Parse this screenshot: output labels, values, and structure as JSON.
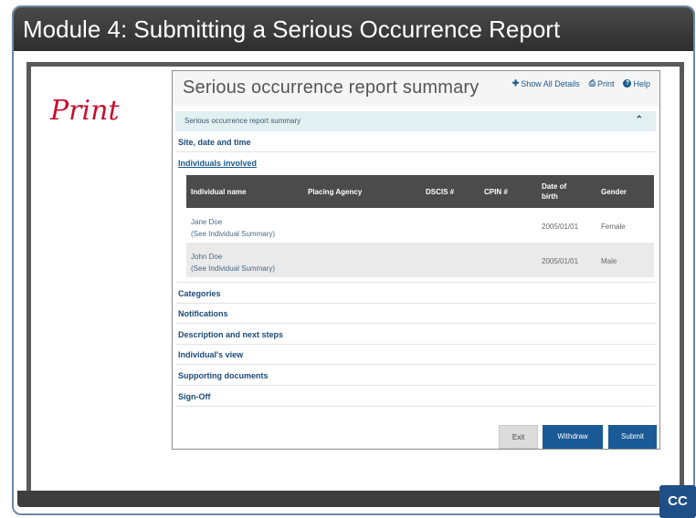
{
  "slide": {
    "title": "Module 4:  Submitting a Serious Occurrence Report",
    "annotation": "Print"
  },
  "app": {
    "title": "Serious occurrence report summary",
    "header_links": {
      "show_all": "Show All Details",
      "print": "Print",
      "help": "Help"
    },
    "section_bar": "Serious occurrence report summary",
    "sections": {
      "site": "Site, date and time",
      "individuals": "Individuals involved",
      "categories": "Categories",
      "notifications": "Notifications",
      "description": "Description and next steps",
      "individual_view": "Individual's view",
      "supporting": "Supporting documents",
      "signoff": "Sign-Off"
    },
    "table": {
      "headers": {
        "name": "Individual name",
        "agency": "Placing Agency",
        "dscis": "DSCIS #",
        "cpin": "CPIN #",
        "dob_line1": "Date of",
        "dob_line2": "birth",
        "gender": "Gender"
      },
      "rows": [
        {
          "name": "Jane Doe",
          "link": "(See Individual Summary)",
          "dob": "2005/01/01",
          "gender": "Female"
        },
        {
          "name": "John Doe",
          "link": "(See Individual Summary)",
          "dob": "2005/01/01",
          "gender": "Male"
        }
      ]
    },
    "buttons": {
      "exit": "Exit",
      "withdraw": "Withdraw",
      "submit": "Submit"
    }
  },
  "cc_label": "CC",
  "colors": {
    "accent": "#1a5a96",
    "annotation": "#c8102e",
    "section_bar": "#e3f0f1"
  }
}
